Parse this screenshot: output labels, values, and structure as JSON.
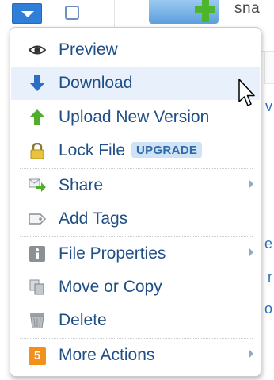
{
  "background": {
    "file_name_partial": "sna",
    "right_edge_fragments": [
      "v",
      "e",
      "r",
      "o"
    ]
  },
  "menu": {
    "items": [
      {
        "id": "preview",
        "label": "Preview",
        "icon": "eye-icon"
      },
      {
        "id": "download",
        "label": "Download",
        "icon": "download-arrow-icon"
      },
      {
        "id": "upload",
        "label": "Upload New Version",
        "icon": "upload-arrow-icon"
      },
      {
        "id": "lock",
        "label": "Lock File",
        "icon": "lock-icon",
        "badge": "UPGRADE"
      },
      {
        "id": "share",
        "label": "Share",
        "icon": "share-icon",
        "submenu": true
      },
      {
        "id": "tags",
        "label": "Add Tags",
        "icon": "tag-icon"
      },
      {
        "id": "properties",
        "label": "File Properties",
        "icon": "info-icon",
        "submenu": true
      },
      {
        "id": "move",
        "label": "Move or Copy",
        "icon": "copy-icon"
      },
      {
        "id": "delete",
        "label": "Delete",
        "icon": "trash-icon"
      },
      {
        "id": "more",
        "label": "More Actions",
        "icon": "count-badge-icon",
        "count": "5",
        "submenu": true
      }
    ],
    "hovered_item": "download"
  },
  "colors": {
    "menu_text": "#1f4f86",
    "hover_bg": "#e8f1fb",
    "upgrade_badge_bg": "#cfe3f5",
    "more_actions_badge": "#f39019",
    "toggle_blue": "#2f7ed8"
  }
}
